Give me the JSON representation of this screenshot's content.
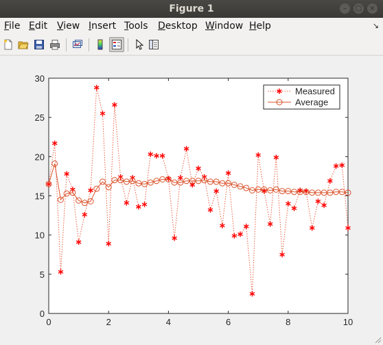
{
  "window": {
    "title": "Figure 1",
    "buttons": {
      "minimize": "–",
      "maximize": "□",
      "close": "×"
    }
  },
  "menu": {
    "items": [
      {
        "ul": "F",
        "rest": "ile"
      },
      {
        "ul": "E",
        "rest": "dit"
      },
      {
        "ul": "V",
        "rest": "iew"
      },
      {
        "ul": "I",
        "rest": "nsert"
      },
      {
        "ul": "T",
        "rest": "ools"
      },
      {
        "ul": "D",
        "rest": "esktop"
      },
      {
        "ul": "W",
        "rest": "indow"
      },
      {
        "ul": "H",
        "rest": "elp"
      }
    ],
    "undock_glyph": "↘"
  },
  "toolbar": {
    "buttons": [
      "new-figure-icon",
      "open-file-icon",
      "save-icon",
      "print-icon",
      "link-plot-icon",
      "colorbar-icon",
      "legend-icon",
      "pointer-icon",
      "property-editor-icon"
    ],
    "active": "legend-icon"
  },
  "chart_data": {
    "type": "line",
    "x_ticks": [
      "0",
      "2",
      "4",
      "6",
      "8",
      "10"
    ],
    "y_ticks": [
      "0",
      "5",
      "10",
      "15",
      "20",
      "25",
      "30"
    ],
    "xlim": [
      0,
      10
    ],
    "ylim": [
      0,
      30
    ],
    "grid": false,
    "legend_position": "top-right",
    "x": [
      0,
      0.2,
      0.4,
      0.6,
      0.8,
      1.0,
      1.2,
      1.4,
      1.6,
      1.8,
      2.0,
      2.2,
      2.4,
      2.6,
      2.8,
      3.0,
      3.2,
      3.4,
      3.6,
      3.8,
      4.0,
      4.2,
      4.4,
      4.6,
      4.8,
      5.0,
      5.2,
      5.4,
      5.6,
      5.8,
      6.0,
      6.2,
      6.4,
      6.6,
      6.8,
      7.0,
      7.2,
      7.4,
      7.6,
      7.8,
      8.0,
      8.2,
      8.4,
      8.6,
      8.8,
      9.0,
      9.2,
      9.4,
      9.6,
      9.8,
      10.0
    ],
    "series": [
      {
        "name": "Measured",
        "color": "#ff0000",
        "line_color": "#e8593a",
        "line_style": "dotted",
        "marker": "asterisk",
        "values": [
          16.5,
          21.7,
          5.3,
          17.8,
          15.8,
          9.1,
          12.6,
          15.7,
          28.8,
          25.5,
          8.9,
          26.6,
          17.4,
          14.1,
          17.3,
          13.6,
          13.9,
          20.3,
          20.1,
          20.1,
          17.2,
          9.6,
          17.3,
          21.0,
          16.4,
          18.5,
          17.4,
          13.2,
          15.6,
          11.2,
          17.9,
          9.9,
          10.1,
          11.1,
          2.5,
          20.2,
          15.6,
          11.4,
          19.9,
          7.5,
          14.0,
          13.4,
          15.7,
          15.6,
          10.9,
          14.3,
          13.8,
          16.9,
          18.8,
          18.9,
          10.9
        ]
      },
      {
        "name": "Average",
        "color": "#d9532b",
        "line_style": "solid",
        "marker": "circle",
        "values": [
          16.5,
          19.1,
          14.5,
          15.3,
          15.4,
          14.4,
          14.1,
          14.3,
          15.9,
          16.8,
          16.1,
          17.0,
          17.0,
          16.8,
          16.9,
          16.6,
          16.5,
          16.7,
          16.9,
          17.1,
          17.1,
          16.7,
          16.7,
          16.9,
          16.9,
          16.9,
          17.0,
          16.8,
          16.8,
          16.6,
          16.6,
          16.4,
          16.2,
          16.0,
          15.7,
          15.8,
          15.8,
          15.7,
          15.8,
          15.6,
          15.6,
          15.5,
          15.5,
          15.5,
          15.4,
          15.4,
          15.4,
          15.4,
          15.5,
          15.5,
          15.4
        ]
      }
    ]
  }
}
